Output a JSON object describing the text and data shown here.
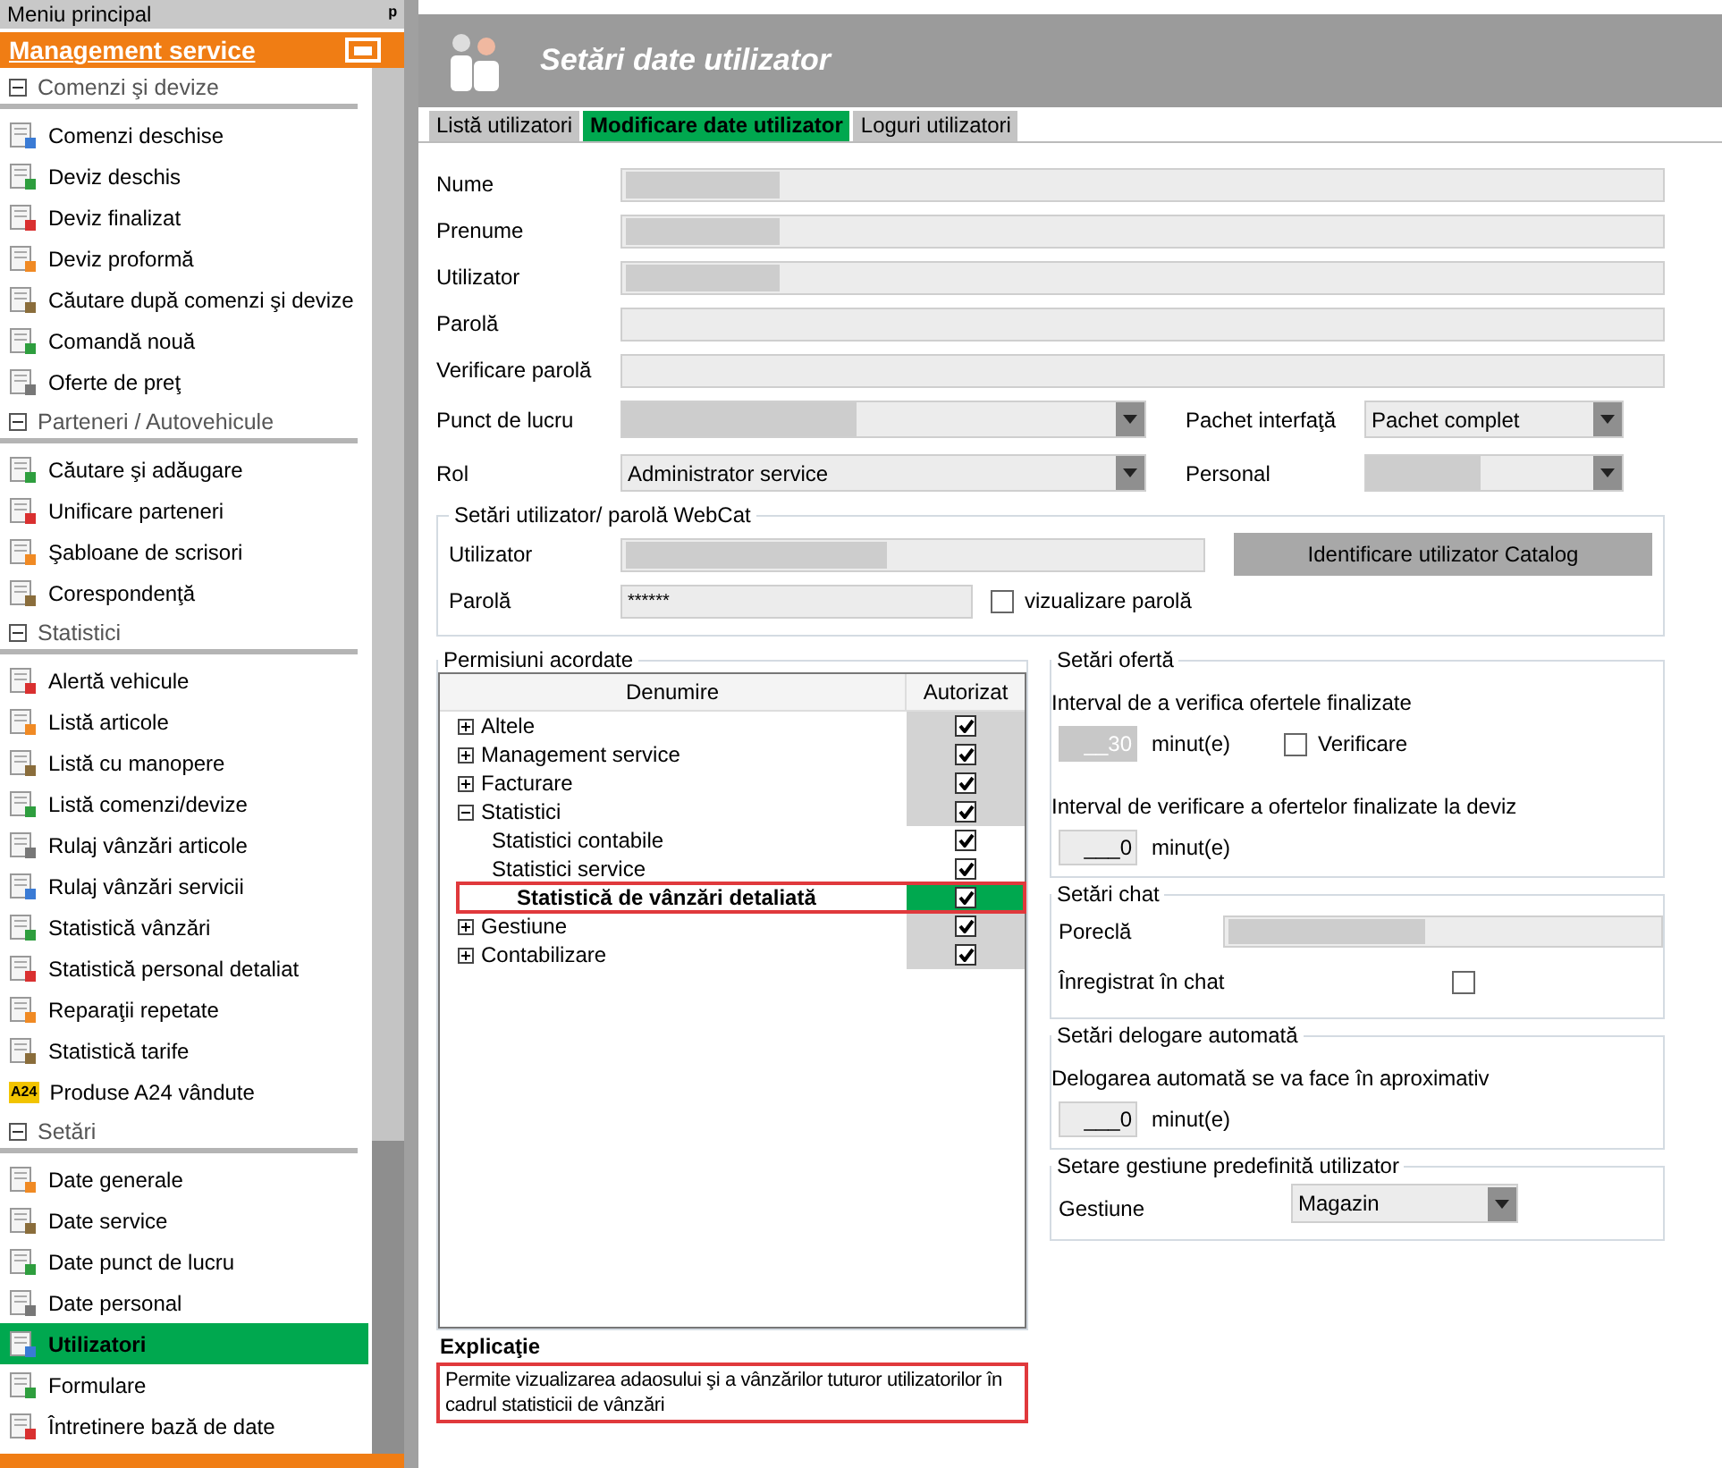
{
  "sidebar": {
    "title": "Meniu principal",
    "pin": "ᵖ",
    "module": "Management service",
    "sections": [
      {
        "label": "Comenzi şi devize",
        "expanded": true,
        "items": [
          {
            "label": "Comenzi deschise",
            "selected": false
          },
          {
            "label": "Deviz deschis",
            "selected": false
          },
          {
            "label": "Deviz finalizat",
            "selected": false
          },
          {
            "label": "Deviz proformă",
            "selected": false
          },
          {
            "label": "Căutare după comenzi şi devize",
            "selected": false
          },
          {
            "label": "Comandă nouă",
            "selected": false
          },
          {
            "label": "Oferte de preţ",
            "selected": false
          }
        ]
      },
      {
        "label": "Parteneri / Autovehicule",
        "expanded": true,
        "items": [
          {
            "label": "Căutare şi adăugare",
            "selected": false
          },
          {
            "label": "Unificare parteneri",
            "selected": false
          },
          {
            "label": "Şabloane de scrisori",
            "selected": false
          },
          {
            "label": "Corespondenţă",
            "selected": false
          }
        ]
      },
      {
        "label": "Statistici",
        "expanded": true,
        "items": [
          {
            "label": "Alertă vehicule",
            "selected": false
          },
          {
            "label": "Listă articole",
            "selected": false
          },
          {
            "label": "Listă cu manopere",
            "selected": false
          },
          {
            "label": "Listă comenzi/devize",
            "selected": false
          },
          {
            "label": "Rulaj vânzări articole",
            "selected": false
          },
          {
            "label": "Rulaj vânzări servicii",
            "selected": false
          },
          {
            "label": "Statistică vânzări",
            "selected": false
          },
          {
            "label": "Statistică personal detaliat",
            "selected": false
          },
          {
            "label": "Reparaţii repetate",
            "selected": false
          },
          {
            "label": "Statistică tarife",
            "selected": false
          },
          {
            "label": "Produse A24 vândute",
            "selected": false,
            "icon_text": "A24"
          }
        ]
      },
      {
        "label": "Setări",
        "expanded": true,
        "items": [
          {
            "label": "Date generale",
            "selected": false
          },
          {
            "label": "Date service",
            "selected": false
          },
          {
            "label": "Date punct de lucru",
            "selected": false
          },
          {
            "label": "Date personal",
            "selected": false
          },
          {
            "label": "Utilizatori",
            "selected": true
          },
          {
            "label": "Formulare",
            "selected": false
          },
          {
            "label": "Întretinere bază de date",
            "selected": false
          }
        ]
      }
    ]
  },
  "header": {
    "title": "Setări date utilizator"
  },
  "tabs": [
    {
      "label": "Listă utilizatori",
      "selected": false
    },
    {
      "label": "Modificare date utilizator",
      "selected": true
    },
    {
      "label": "Loguri utilizatori",
      "selected": false
    }
  ],
  "fields": [
    {
      "label": "Nume",
      "redacted": true
    },
    {
      "label": "Prenume",
      "redacted": true
    },
    {
      "label": "Utilizator",
      "redacted": true
    },
    {
      "label": "Parolă"
    },
    {
      "label": "Verificare parolă"
    }
  ],
  "combos": [
    {
      "label": "Punct de lucru",
      "redacted": true
    },
    {
      "label": "Pachet interfaţă",
      "value": "Pachet complet"
    },
    {
      "label": "Rol",
      "value": "Administrator service"
    },
    {
      "label": "Personal",
      "redacted": true
    }
  ],
  "webcat": {
    "title": "Setări utilizator/ parolă WebCat",
    "user_label": "Utilizator",
    "user_redacted": true,
    "button": "Identificare utilizator Catalog",
    "password_label": "Parolă",
    "password": "******",
    "show_password": {
      "label": "vizualizare parolă",
      "checked": false
    }
  },
  "permissions": {
    "title": "Permisiuni acordate",
    "columns": [
      "Denumire",
      "Autorizat"
    ],
    "rows": [
      {
        "label": "Altele",
        "expanded": false,
        "checked": true,
        "selected": false
      },
      {
        "label": "Management service",
        "expanded": false,
        "checked": true,
        "selected": false
      },
      {
        "label": "Facturare",
        "expanded": false,
        "checked": true,
        "selected": false
      },
      {
        "label": "Statistici",
        "expanded": true,
        "checked": true,
        "selected": false,
        "children": [
          {
            "label": "Statistici contabile",
            "checked": true,
            "selected": false
          },
          {
            "label": "Statistici service",
            "checked": true,
            "selected": false
          },
          {
            "label": "Statistică de vânzări detaliată",
            "checked": true,
            "selected": true
          }
        ]
      },
      {
        "label": "Gestiune",
        "expanded": false,
        "checked": true,
        "selected": false
      },
      {
        "label": "Contabilizare",
        "expanded": false,
        "checked": true,
        "selected": false
      }
    ],
    "explanation_title": "Explicaţie",
    "explanation": "Permite vizualizarea adaosului şi a vânzărilor tuturor utilizatorilor în cadrul statisticii de vânzări"
  },
  "offer": {
    "title": "Setări ofertă",
    "interval_label": "Interval de a verifica ofertele finalizate",
    "interval_value": "__30",
    "interval_disabled": true,
    "unit": "minut(e)",
    "verify": {
      "label": "Verificare",
      "checked": false
    },
    "deviz_label": "Interval de verificare a ofertelor finalizate la deviz",
    "deviz_value": "___0",
    "deviz_unit": "minut(e)"
  },
  "chat": {
    "title": "Setări chat",
    "nickname_label": "Poreclă",
    "nickname_redacted": true,
    "registered": {
      "label": "Înregistrat în chat",
      "checked": false
    }
  },
  "logout": {
    "title": "Setări delogare automată",
    "label": "Delogarea automată se va face în aproximativ",
    "value": "___0",
    "unit": "minut(e)"
  },
  "store": {
    "title": "Setare gestiune predefinită utilizator",
    "label": "Gestiune",
    "value": "Magazin"
  }
}
